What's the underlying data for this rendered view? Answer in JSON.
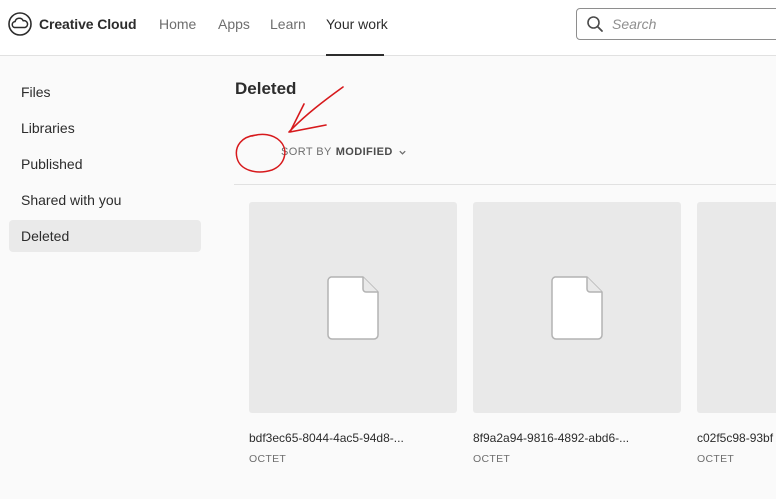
{
  "header": {
    "app_name": "Creative Cloud",
    "logo_icon": "creative-cloud-logo",
    "nav": [
      {
        "label": "Home",
        "active": false
      },
      {
        "label": "Apps",
        "active": false
      },
      {
        "label": "Learn",
        "active": false
      },
      {
        "label": "Your work",
        "active": true
      }
    ],
    "search": {
      "placeholder": "Search",
      "value": "",
      "icon": "search-icon"
    }
  },
  "sidebar": {
    "items": [
      {
        "label": "Files",
        "selected": false
      },
      {
        "label": "Libraries",
        "selected": false
      },
      {
        "label": "Published",
        "selected": false
      },
      {
        "label": "Shared with you",
        "selected": false
      },
      {
        "label": "Deleted",
        "selected": true
      }
    ]
  },
  "main": {
    "title": "Deleted",
    "sort": {
      "label": "SORT BY",
      "value": "MODIFIED",
      "icon": "chevron-down-icon"
    },
    "files": [
      {
        "name": "bdf3ec65-8044-4ac5-94d8-...",
        "type": "OCTET",
        "icon": "file-icon"
      },
      {
        "name": "8f9a2a94-9816-4892-abd6-...",
        "type": "OCTET",
        "icon": "file-icon"
      },
      {
        "name": "c02f5c98-93bf",
        "type": "OCTET",
        "icon": "file-icon"
      }
    ]
  },
  "annotation": {
    "color": "#d7191c",
    "shapes": [
      "arrow",
      "circle"
    ]
  },
  "colors": {
    "text": "#2c2c2c",
    "muted": "#6e6e6e",
    "thumb_bg": "#e9e9e9",
    "selected_bg": "#eaeaea"
  }
}
